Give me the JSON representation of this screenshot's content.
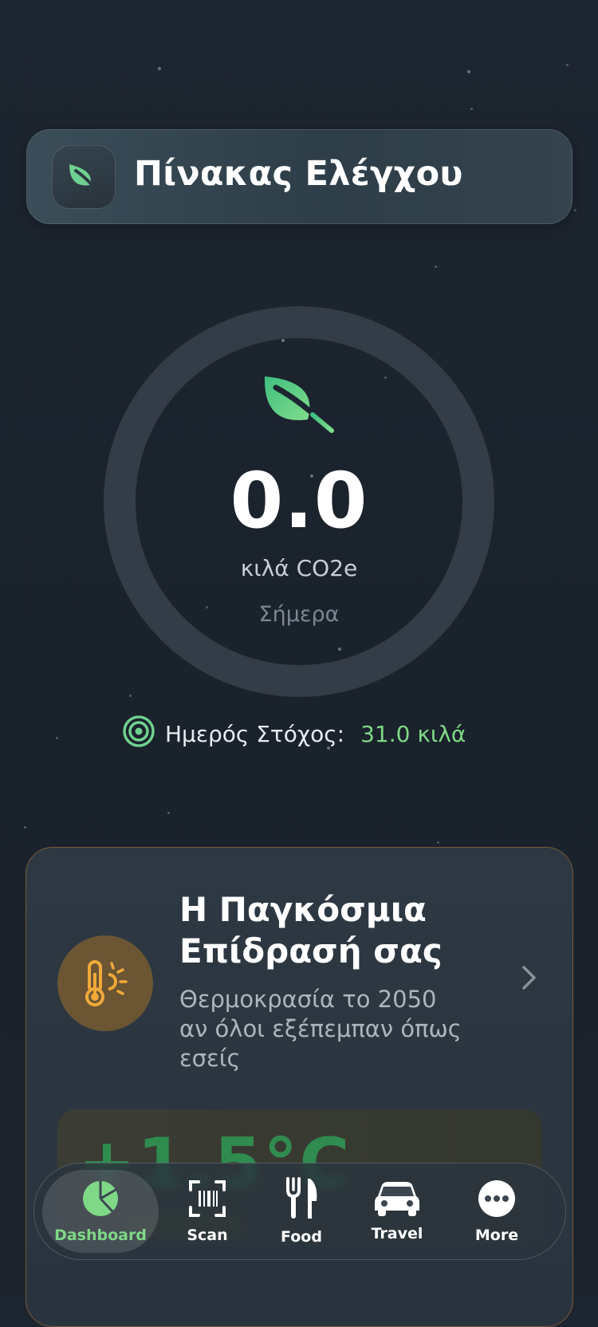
{
  "header": {
    "title": "Πίνακας Ελέγχου",
    "icon": "leaf-icon"
  },
  "today": {
    "value": "0.0",
    "unit": "κιλά CO2e",
    "period": "Σήμερα",
    "progress_fraction": 0
  },
  "goal": {
    "label": "Ημερός Στόχος:",
    "value": "31.0 κιλά"
  },
  "impact": {
    "title": "Η Παγκόσμια Επίδρασή σας",
    "description": "Θερμοκρασία το 2050 αν όλοι εξέπεμπαν όπως εσείς",
    "temperature": "+1.5°C",
    "icon": "thermometer-sun-icon"
  },
  "nav": {
    "items": [
      {
        "label": "Dashboard",
        "icon": "pie-chart-icon",
        "active": true
      },
      {
        "label": "Scan",
        "icon": "barcode-scan-icon",
        "active": false
      },
      {
        "label": "Food",
        "icon": "fork-knife-icon",
        "active": false
      },
      {
        "label": "Travel",
        "icon": "car-icon",
        "active": false
      },
      {
        "label": "More",
        "icon": "more-icon",
        "active": false
      }
    ]
  },
  "colors": {
    "accent": "#7fd886",
    "leaf": "#5fcf8a",
    "warm": "#f0a93a",
    "background": "#1c232d"
  }
}
